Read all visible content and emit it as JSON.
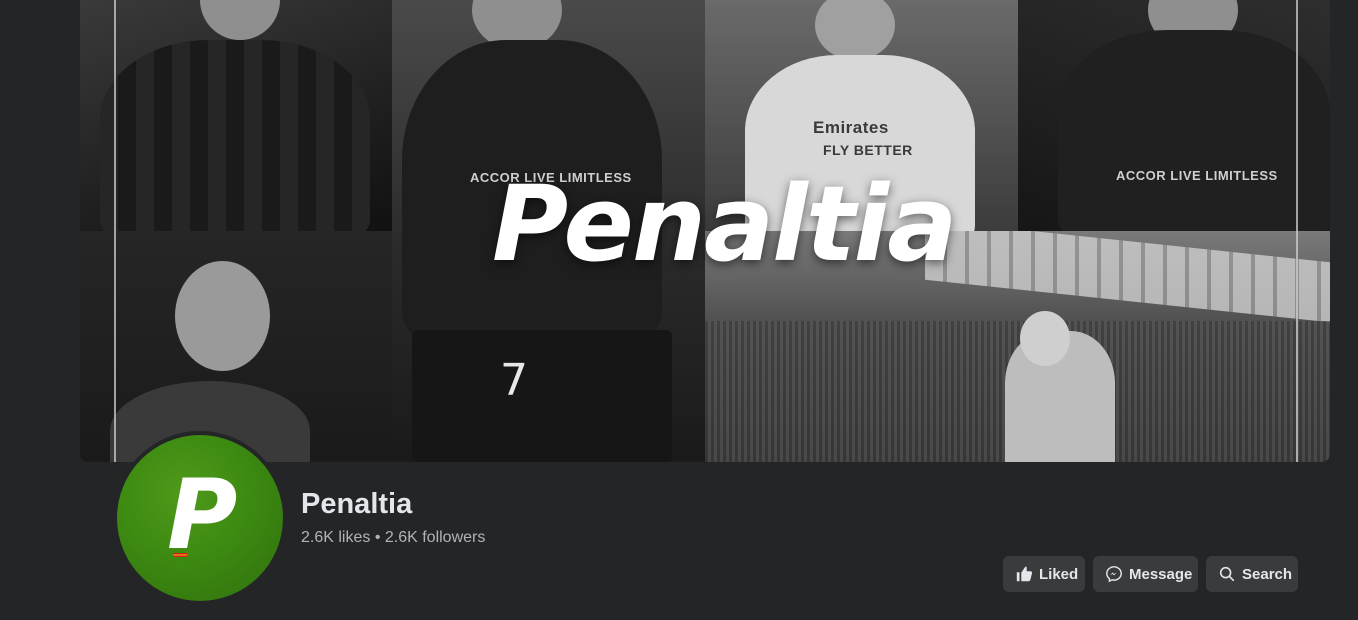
{
  "cover": {
    "brand_text": "Penaltia",
    "jersey_texts": [
      "Emirates",
      "FLY BETTER",
      "ACCOR LIVE LIMITLESS",
      "ACCOR LIVE LIMITLESS"
    ],
    "shirt_number": "7"
  },
  "profile": {
    "name": "Penaltia",
    "stats": "2.6K likes • 2.6K followers",
    "avatar_letter": "P",
    "brand_color": "#3d8a12"
  },
  "actions": {
    "liked_label": "Liked",
    "liked_icon": "thumbs-up-icon",
    "message_label": "Message",
    "message_icon": "messenger-icon",
    "search_label": "Search",
    "search_icon": "search-icon"
  },
  "colors": {
    "background": "#242526",
    "button_bg": "#3a3b3c",
    "text_primary": "#e4e6eb",
    "text_secondary": "#b0b3b8"
  }
}
